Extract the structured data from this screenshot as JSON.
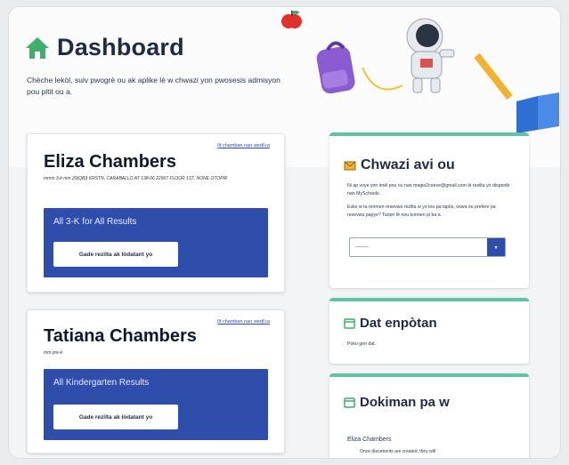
{
  "header": {
    "title": "Dashboard",
    "subtitle": "Chèche lekòl, suiv pwogrè ou ak aplike lè w chwazi yon pwosesis admisyon pou pitit ou a."
  },
  "students": [
    {
      "name": "Eliza Chambers",
      "link": "Ilt chamban nan wedi'ca",
      "meta": "mmm 3-k mm 29(QBI) KRSTN, CARABALLO AT 138-06 22907 FLOOR 1ST, NONE OTOPRI",
      "results_title": "All 3-K for All Results",
      "button": "Gade rezilta ak lòdatant yo"
    },
    {
      "name": "Tatiana Chambers",
      "link": "Ilt chamban nan wedi'ca",
      "meta": "mm pre-k",
      "results_title": "All Kindergarten Results",
      "button": "Gade rezilta ak lòdatant yo"
    }
  ],
  "panels": {
    "choose": {
      "title": "Chwazi avi ou",
      "text1": "Ni ap voye yon imèl pou ou nan magie2ceeve@gmail.com lè rezilta yo disponib nan MySchools.",
      "text2": "Eske w ta renmen resevwa rezilta w yo tou pa lapòs, oswa ou prefere pa resevwa papye? Tanpri fè nou konnen pi ba a.",
      "select_value": "———"
    },
    "deadline": {
      "title": "Dat enpòtan",
      "text": "Poko gen dat."
    },
    "documents": {
      "title": "Dokiman pa w",
      "student": "Eliza Chambers",
      "text": "Once documents are created, they will"
    }
  },
  "colors": {
    "accent_blue": "#2f4dab",
    "accent_green": "#3fae6e",
    "panel_border": "#5fc4a6"
  }
}
